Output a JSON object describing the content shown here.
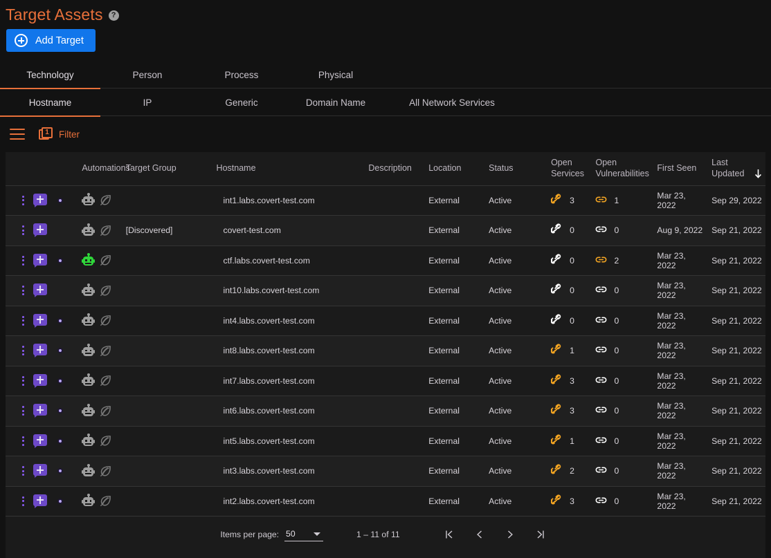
{
  "header": {
    "title": "Target Assets",
    "help_icon": "help-circle-icon",
    "add_button": "Add Target"
  },
  "tabs_primary": [
    {
      "label": "Technology",
      "active": true
    },
    {
      "label": "Person",
      "active": false
    },
    {
      "label": "Process",
      "active": false
    },
    {
      "label": "Physical",
      "active": false
    }
  ],
  "tabs_secondary": [
    {
      "label": "Hostname",
      "active": true
    },
    {
      "label": "IP",
      "active": false
    },
    {
      "label": "Generic",
      "active": false
    },
    {
      "label": "Domain Name",
      "active": false
    },
    {
      "label": "All Network Services",
      "active": false
    }
  ],
  "toolbar": {
    "menu_icon": "hamburger-icon",
    "filter_label": "Filter",
    "filter_count": "1"
  },
  "table": {
    "columns": [
      "",
      "Automations",
      "Target Group",
      "Hostname",
      "Description",
      "Location",
      "Status",
      "Open Services",
      "Open Vulnerabilities",
      "First Seen",
      "Last Updated"
    ],
    "columns_split": {
      "open_services": [
        "Open",
        "Services"
      ],
      "open_vulnerabilities": [
        "Open",
        "Vulnerabilities"
      ],
      "last_updated": [
        "Last",
        "Updated"
      ]
    },
    "sort_column": "Last Updated",
    "sort_direction": "down",
    "rows": [
      {
        "has_eye": true,
        "robot": "gray",
        "target_group": "",
        "hostname": "int1.labs.covert-test.com",
        "description": "",
        "location": "External",
        "status": "Active",
        "open_services": "3",
        "open_vulnerabilities": "1",
        "first_seen": "Mar 23, 2022",
        "last_updated": "Sep 29, 2022"
      },
      {
        "has_eye": false,
        "robot": "gray",
        "target_group": "[Discovered]",
        "hostname": "covert-test.com",
        "description": "",
        "location": "External",
        "status": "Active",
        "open_services": "0",
        "open_vulnerabilities": "0",
        "first_seen": "Aug 9, 2022",
        "last_updated": "Sep 21, 2022"
      },
      {
        "has_eye": true,
        "robot": "green",
        "target_group": "",
        "hostname": "ctf.labs.covert-test.com",
        "description": "",
        "location": "External",
        "status": "Active",
        "open_services": "0",
        "open_vulnerabilities": "2",
        "first_seen": "Mar 23, 2022",
        "last_updated": "Sep 21, 2022"
      },
      {
        "has_eye": false,
        "robot": "gray",
        "target_group": "",
        "hostname": "int10.labs.covert-test.com",
        "description": "",
        "location": "External",
        "status": "Active",
        "open_services": "0",
        "open_vulnerabilities": "0",
        "first_seen": "Mar 23, 2022",
        "last_updated": "Sep 21, 2022"
      },
      {
        "has_eye": true,
        "robot": "gray",
        "target_group": "",
        "hostname": "int4.labs.covert-test.com",
        "description": "",
        "location": "External",
        "status": "Active",
        "open_services": "0",
        "open_vulnerabilities": "0",
        "first_seen": "Mar 23, 2022",
        "last_updated": "Sep 21, 2022"
      },
      {
        "has_eye": true,
        "robot": "gray",
        "target_group": "",
        "hostname": "int8.labs.covert-test.com",
        "description": "",
        "location": "External",
        "status": "Active",
        "open_services": "1",
        "open_vulnerabilities": "0",
        "first_seen": "Mar 23, 2022",
        "last_updated": "Sep 21, 2022"
      },
      {
        "has_eye": true,
        "robot": "gray",
        "target_group": "",
        "hostname": "int7.labs.covert-test.com",
        "description": "",
        "location": "External",
        "status": "Active",
        "open_services": "3",
        "open_vulnerabilities": "0",
        "first_seen": "Mar 23, 2022",
        "last_updated": "Sep 21, 2022"
      },
      {
        "has_eye": true,
        "robot": "gray",
        "target_group": "",
        "hostname": "int6.labs.covert-test.com",
        "description": "",
        "location": "External",
        "status": "Active",
        "open_services": "3",
        "open_vulnerabilities": "0",
        "first_seen": "Mar 23, 2022",
        "last_updated": "Sep 21, 2022"
      },
      {
        "has_eye": true,
        "robot": "gray",
        "target_group": "",
        "hostname": "int5.labs.covert-test.com",
        "description": "",
        "location": "External",
        "status": "Active",
        "open_services": "1",
        "open_vulnerabilities": "0",
        "first_seen": "Mar 23, 2022",
        "last_updated": "Sep 21, 2022"
      },
      {
        "has_eye": true,
        "robot": "gray",
        "target_group": "",
        "hostname": "int3.labs.covert-test.com",
        "description": "",
        "location": "External",
        "status": "Active",
        "open_services": "2",
        "open_vulnerabilities": "0",
        "first_seen": "Mar 23, 2022",
        "last_updated": "Sep 21, 2022"
      },
      {
        "has_eye": true,
        "robot": "gray",
        "target_group": "",
        "hostname": "int2.labs.covert-test.com",
        "description": "",
        "location": "External",
        "status": "Active",
        "open_services": "3",
        "open_vulnerabilities": "0",
        "first_seen": "Mar 23, 2022",
        "last_updated": "Sep 21, 2022"
      }
    ]
  },
  "footer": {
    "items_per_page_label": "Items per page:",
    "items_per_page_value": "50",
    "range_label": "1 – 11 of 11",
    "first_page_icon": "first-page-icon",
    "prev_page_icon": "previous-page-icon",
    "next_page_icon": "next-page-icon",
    "last_page_icon": "last-page-icon"
  },
  "colors": {
    "accent": "#e8703a",
    "primary_button": "#1176eb",
    "link_active": "#f5a623",
    "link_zero": "#ffffff",
    "robot_active": "#2fd63a",
    "robot_inactive": "#9e9e9e",
    "purple_icon": "#7c5cf0"
  }
}
